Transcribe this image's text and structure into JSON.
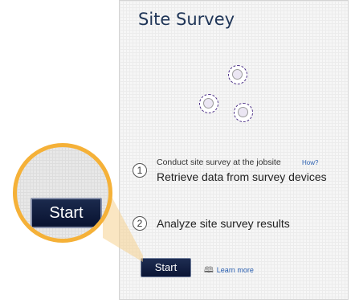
{
  "panel": {
    "title": "Site Survey",
    "devices": [
      "device-icon",
      "device-icon",
      "device-icon"
    ],
    "steps": [
      {
        "number": "1",
        "sub_text": "Conduct site survey at the jobsite",
        "link": "How?",
        "main_text": "Retrieve data from survey devices"
      },
      {
        "number": "2",
        "main_text": "Analyze site survey results"
      }
    ],
    "start_label": "Start",
    "learn_more": "Learn more",
    "learn_more_icon": "book-icon"
  },
  "magnifier": {
    "start_label": "Start"
  },
  "colors": {
    "accent": "#f5b138",
    "button": "#0b1535",
    "title": "#1f3557",
    "link": "#2a5fb0"
  }
}
